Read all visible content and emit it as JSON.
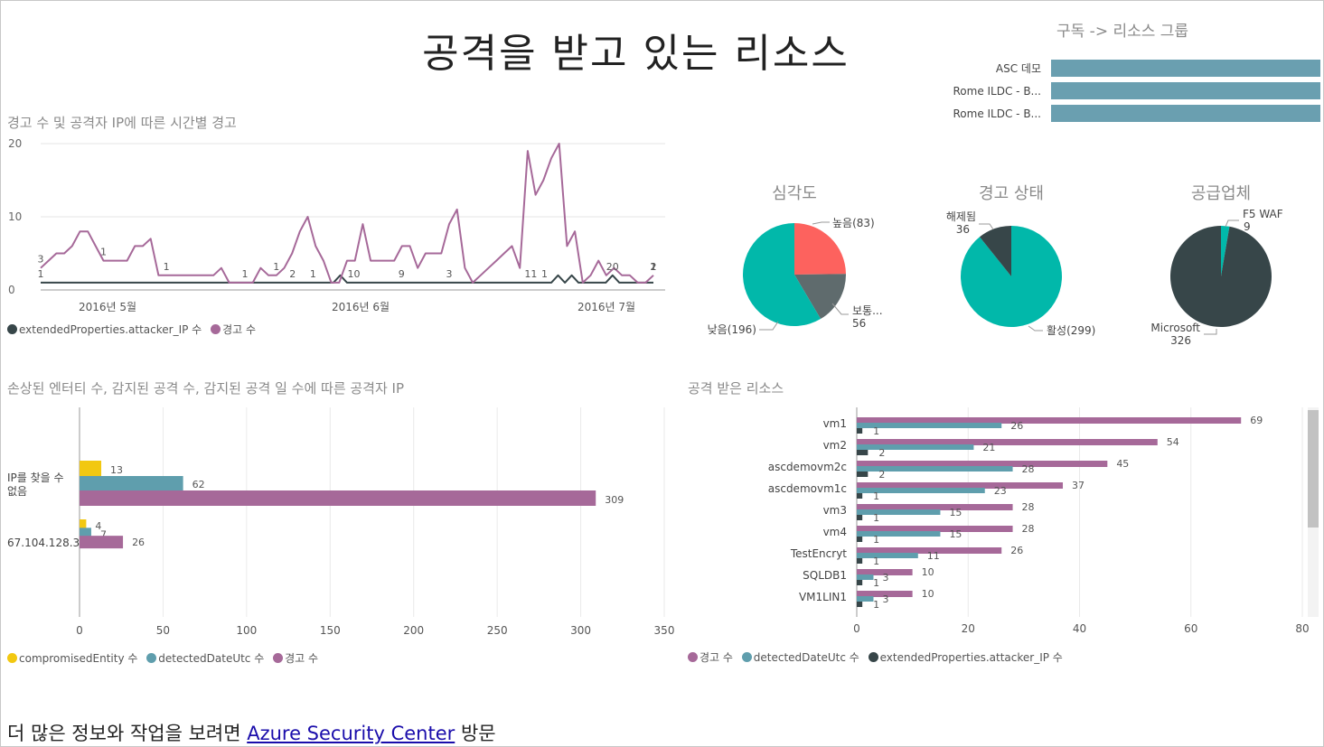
{
  "page_title": "공격을 받고 있는 리소스",
  "footer": {
    "prefix": "더 많은 정보와 작업을 보려면 ",
    "link_text": "Azure Security Center",
    "suffix": " 방문"
  },
  "colors": {
    "purple": "#a66999",
    "dark": "#374649",
    "teal": "#5f9ead",
    "yellow": "#f2c811",
    "pie_teal": "#01b8aa",
    "pie_red": "#fd625e",
    "pie_gray": "#5f6b6d",
    "subscription_bar": "#6a9fb0"
  },
  "chart_data": [
    {
      "id": "timeline",
      "type": "line",
      "title": "경고 수 및 공격자 IP에 따른 시간별 경고",
      "ylim": [
        0,
        20
      ],
      "yticks": [
        "0",
        "10",
        "20"
      ],
      "xticks": [
        "2016년 5월",
        "2016년 6월",
        "2016년 7월"
      ],
      "series": [
        {
          "name": "extendedProperties.attacker_IP 수",
          "color": "#374649",
          "values": [
            1,
            1,
            1,
            1,
            1,
            1,
            1,
            1,
            1,
            1,
            1,
            1,
            1,
            1,
            1,
            1,
            1,
            1,
            1,
            1,
            1,
            1,
            1,
            1,
            1,
            1,
            1,
            1,
            1,
            1,
            1,
            1,
            1,
            1,
            1,
            1,
            1,
            1,
            1,
            1,
            1,
            1,
            1,
            1,
            2,
            1,
            1,
            1,
            1,
            1,
            1,
            1,
            1,
            1,
            1,
            1,
            1,
            1,
            1,
            1,
            1,
            1,
            1,
            1,
            1,
            1,
            1,
            1,
            1,
            1,
            1,
            1,
            1,
            1,
            1,
            1,
            2,
            1,
            2,
            1,
            1,
            1,
            1,
            1,
            2,
            1,
            1,
            1,
            1,
            1,
            1
          ]
        },
        {
          "name": "경고 수",
          "color": "#a66999",
          "values": [
            3,
            4,
            5,
            5,
            6,
            8,
            8,
            6,
            4,
            4,
            4,
            4,
            6,
            6,
            7,
            2,
            2,
            2,
            2,
            2,
            2,
            2,
            2,
            3,
            1,
            1,
            1,
            1,
            3,
            2,
            2,
            3,
            5,
            8,
            10,
            6,
            4,
            1,
            1,
            4,
            4,
            9,
            4,
            4,
            4,
            4,
            6,
            6,
            3,
            5,
            5,
            5,
            9,
            11,
            3,
            1,
            2,
            3,
            4,
            5,
            6,
            3,
            19,
            13,
            15,
            18,
            20,
            6,
            8,
            1,
            2,
            4,
            2,
            3,
            2,
            2,
            1,
            1,
            2
          ]
        }
      ],
      "data_labels": [
        {
          "series": 1,
          "index": 0,
          "text": "1"
        },
        {
          "series": 0,
          "index": 0,
          "text": "3"
        },
        {
          "series": 0,
          "index": 8,
          "text": "1"
        },
        {
          "series": 0,
          "index": 16,
          "text": "1"
        },
        {
          "series": 0,
          "index": 26,
          "text": "1"
        },
        {
          "series": 0,
          "index": 30,
          "text": "1"
        },
        {
          "series": 1,
          "index": 37,
          "text": "2"
        },
        {
          "series": 1,
          "index": 40,
          "text": "1"
        },
        {
          "series": 1,
          "index": 46,
          "text": "10"
        },
        {
          "series": 1,
          "index": 53,
          "text": "9"
        },
        {
          "series": 1,
          "index": 60,
          "text": "3"
        },
        {
          "series": 1,
          "index": 72,
          "text": "11"
        },
        {
          "series": 1,
          "index": 74,
          "text": "1"
        },
        {
          "series": 0,
          "index": 78,
          "text": "2"
        },
        {
          "series": 0,
          "index": 80,
          "text": "1"
        },
        {
          "series": 1,
          "index": 84,
          "text": "20"
        },
        {
          "series": 0,
          "index": 86,
          "text": "2"
        },
        {
          "series": 0,
          "index": 88,
          "text": "1"
        },
        {
          "series": 0,
          "index": 90,
          "text": "1"
        }
      ],
      "legend": [
        "extendedProperties.attacker_IP 수",
        "경고 수"
      ]
    },
    {
      "id": "subscription",
      "type": "bar",
      "title": "구독 -> 리소스 그룹",
      "categories": [
        "ASC 데모",
        "Rome ILDC - B...",
        "Rome ILDC - B..."
      ],
      "values": [
        1,
        1,
        1
      ]
    },
    {
      "id": "severity",
      "type": "pie",
      "title": "심각도",
      "slices": [
        {
          "label": "높음(83)",
          "value": 83,
          "color": "#fd625e"
        },
        {
          "label": "보통...",
          "sub": "56",
          "value": 56,
          "color": "#5f6b6d"
        },
        {
          "label": "낮음(196)",
          "value": 196,
          "color": "#01b8aa"
        }
      ]
    },
    {
      "id": "alert_status",
      "type": "pie",
      "title": "경고 상태",
      "slices": [
        {
          "label": "활성(299)",
          "value": 299,
          "color": "#01b8aa"
        },
        {
          "label": "해제됨",
          "sub": "36",
          "value": 36,
          "color": "#374649"
        }
      ]
    },
    {
      "id": "vendor",
      "type": "pie",
      "title": "공급업체",
      "slices": [
        {
          "label": "F5 WAF",
          "sub": "9",
          "value": 9,
          "color": "#01b8aa"
        },
        {
          "label": "Microsoft",
          "sub": "326",
          "value": 326,
          "color": "#374649"
        }
      ]
    },
    {
      "id": "attacker_ip",
      "type": "bar",
      "title": "손상된 엔터티 수, 감지된 공격 수, 감지된 공격 일 수에 따른 공격자 IP",
      "categories": [
        "IP를 찾을 수 없음",
        "67.104.128.3"
      ],
      "series": [
        {
          "name": "compromisedEntity 수",
          "color": "#f2c811",
          "values": [
            13,
            4
          ]
        },
        {
          "name": "detectedDateUtc 수",
          "color": "#5f9ead",
          "values": [
            62,
            7
          ]
        },
        {
          "name": "경고 수",
          "color": "#a66999",
          "values": [
            309,
            26
          ]
        }
      ],
      "xlim": [
        0,
        350
      ],
      "xticks": [
        0,
        50,
        100,
        150,
        200,
        250,
        300,
        350
      ]
    },
    {
      "id": "attacked_resources",
      "type": "bar",
      "title": "공격 받은 리소스",
      "categories": [
        "vm1",
        "vm2",
        "ascdemovm2c",
        "ascdemovm1c",
        "vm3",
        "vm4",
        "TestEncryt",
        "SQLDB1",
        "VM1LIN1"
      ],
      "series": [
        {
          "name": "경고 수",
          "color": "#a66999",
          "values": [
            69,
            54,
            45,
            37,
            28,
            28,
            26,
            10,
            10
          ]
        },
        {
          "name": "detectedDateUtc 수",
          "color": "#5f9ead",
          "values": [
            26,
            21,
            28,
            23,
            15,
            15,
            11,
            3,
            3
          ]
        },
        {
          "name": "extendedProperties.attacker_IP 수",
          "color": "#374649",
          "values": [
            1,
            2,
            2,
            1,
            1,
            1,
            1,
            1,
            1
          ]
        }
      ],
      "xlim": [
        0,
        80
      ],
      "xticks": [
        0,
        20,
        40,
        60,
        80
      ]
    }
  ]
}
